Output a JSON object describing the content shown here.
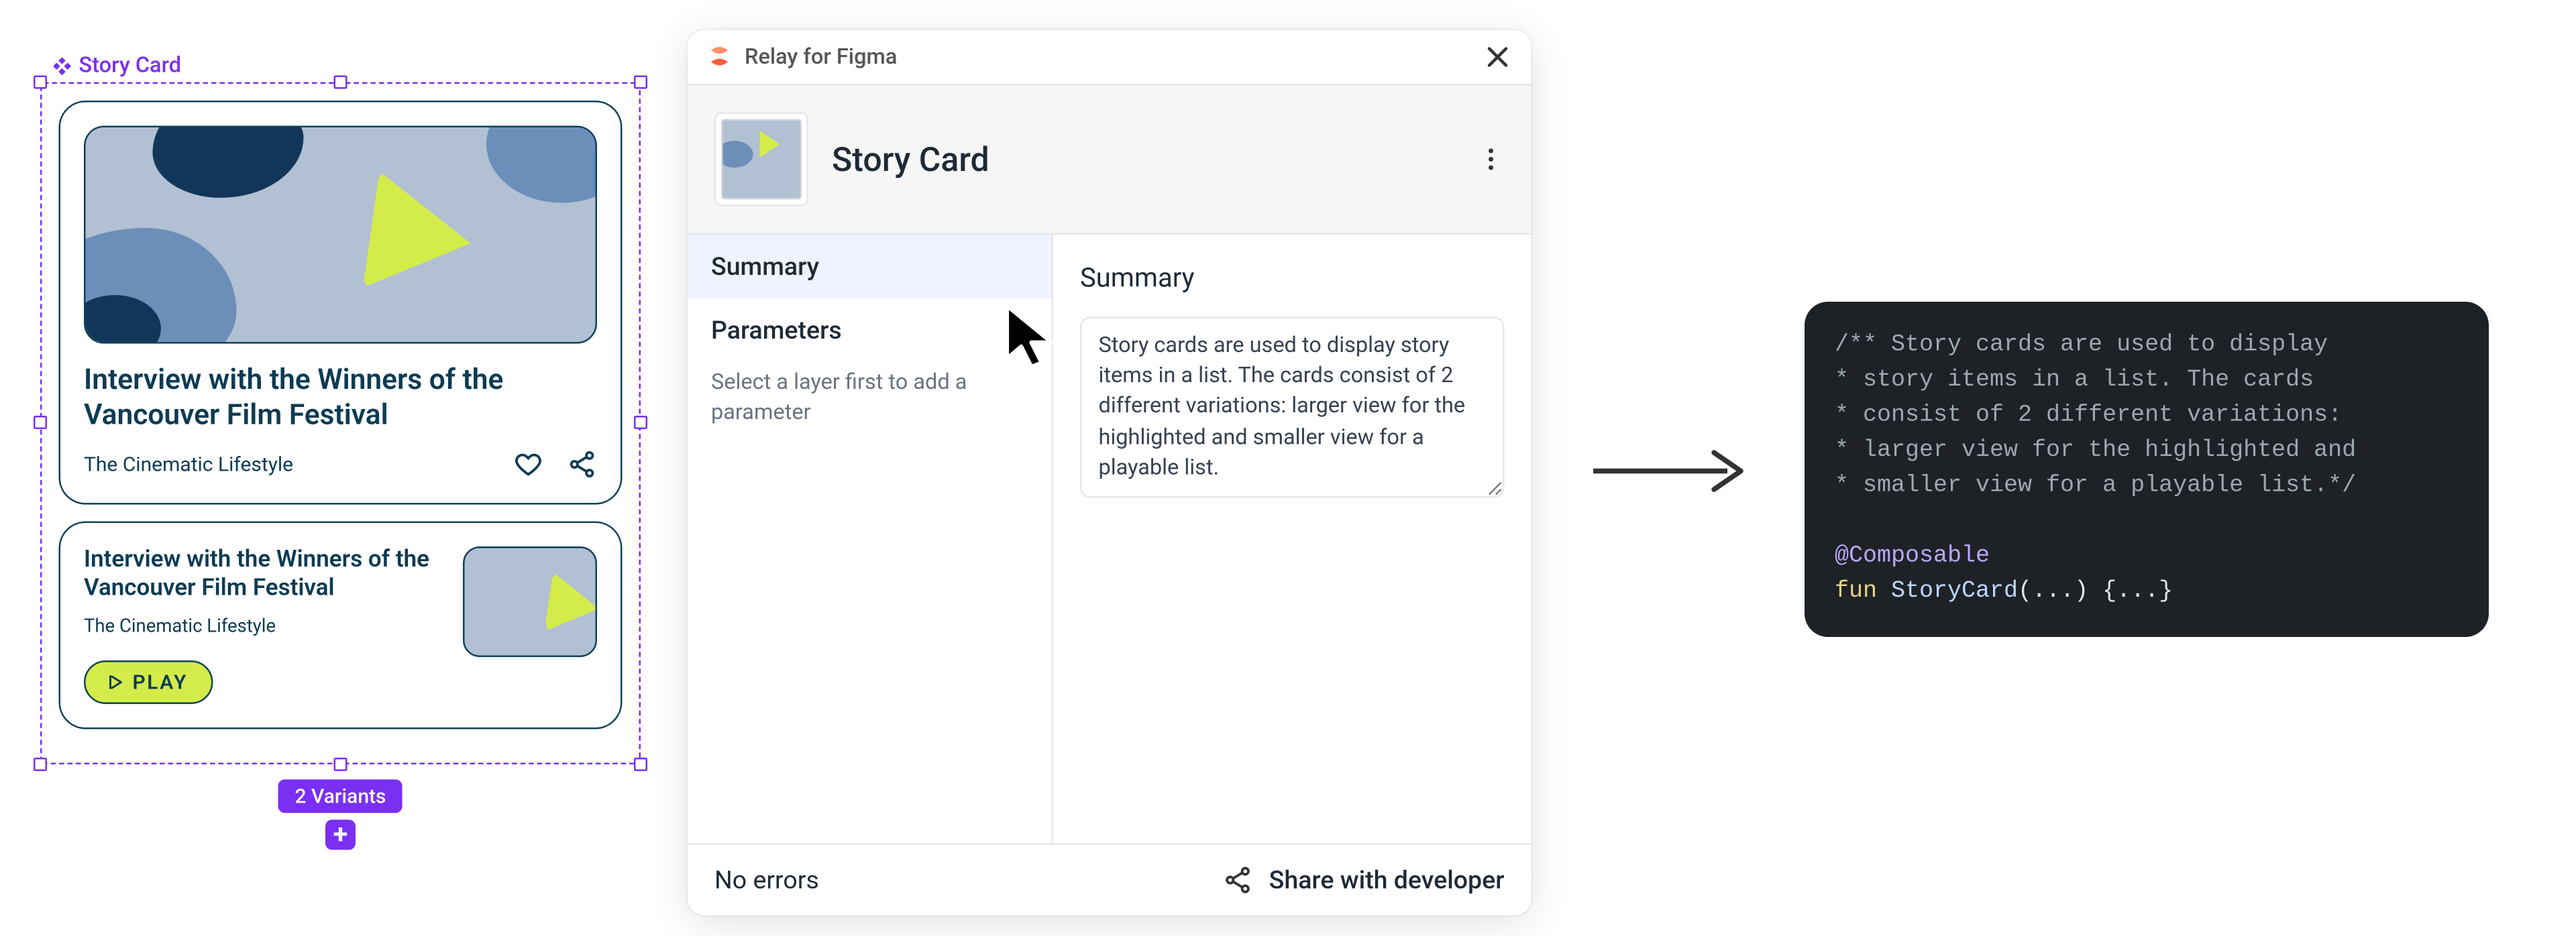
{
  "figma": {
    "component_label": "Story Card",
    "variants_badge": "2 Variants",
    "add_label": "+",
    "card_large": {
      "title": "Interview with the Winners of the Vancouver Film Festival",
      "subtitle": "The Cinematic Lifestyle"
    },
    "card_small": {
      "title": "Interview with the Winners of the Vancouver Film Festival",
      "subtitle": "The Cinematic Lifestyle",
      "play": "PLAY"
    }
  },
  "panel": {
    "plugin_name": "Relay for Figma",
    "component_name": "Story Card",
    "tabs": {
      "summary": "Summary",
      "parameters": "Parameters",
      "parameters_help": "Select a layer first to add a parameter"
    },
    "main": {
      "heading": "Summary",
      "body": "Story cards are used to display story items in a list. The cards consist of 2 different variations: larger view for the highlighted and smaller view for a playable list."
    },
    "footer": {
      "status": "No errors",
      "share": "Share with developer"
    }
  },
  "code": {
    "lines": [
      "/** Story cards are used to display",
      "* story items in a list. The cards",
      "* consist of 2 different variations:",
      "* larger view for the highlighted and",
      "* smaller view for a playable list.*/",
      "",
      "@Composable",
      "fun StoryCard(...) {...}"
    ]
  }
}
